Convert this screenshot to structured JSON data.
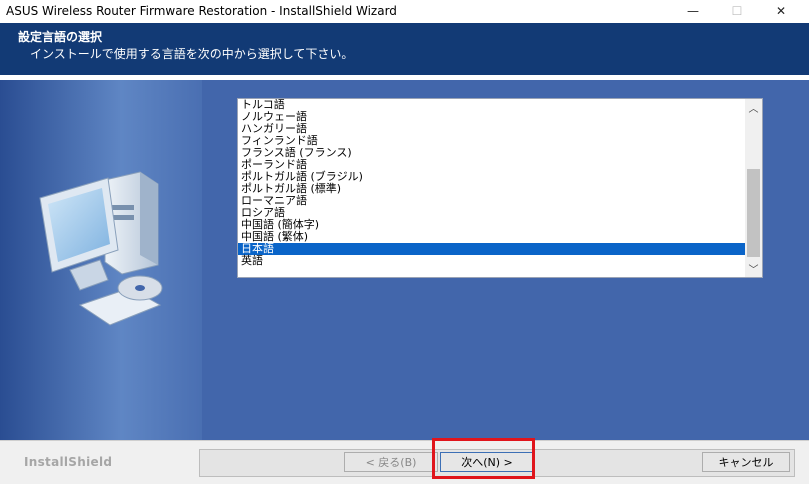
{
  "window": {
    "title": "ASUS Wireless Router Firmware Restoration - InstallShield Wizard",
    "controls": {
      "minimize": "—",
      "maximize": "☐",
      "close": "✕"
    }
  },
  "header": {
    "title": "設定言語の選択",
    "subtitle": "インストールで使用する言語を次の中から選択して下さい。"
  },
  "languages": [
    "トルコ語",
    "ノルウェー語",
    "ハンガリー語",
    "フィンランド語",
    "フランス語 (フランス)",
    "ポーランド語",
    "ポルトガル語 (ブラジル)",
    "ポルトガル語 (標準)",
    "ローマニア語",
    "ロシア語",
    "中国語 (簡体字)",
    "中国語 (繁体)",
    "日本語",
    "英語"
  ],
  "selected_language": "日本語",
  "footer": {
    "logo": "InstallShield",
    "back_label": "< 戻る(B)",
    "next_label": "次へ(N) >",
    "cancel_label": "キャンセル"
  },
  "colors": {
    "header_bg": "#123a75",
    "main_bg": "#4266ab",
    "selection": "#0a64c8",
    "highlight_box": "#e0151c"
  },
  "icons": {
    "computer": "computer-with-cd-icon",
    "scroll_up": "chevron-up-icon",
    "scroll_down": "chevron-down-icon"
  }
}
